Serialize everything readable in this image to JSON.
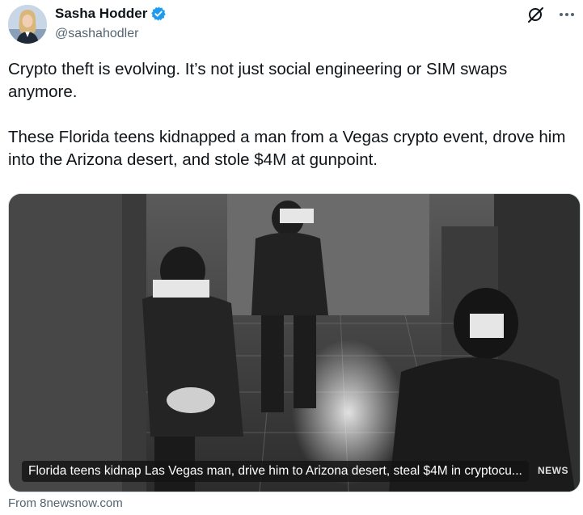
{
  "author": {
    "display_name": "Sasha Hodder",
    "handle": "@sashahodler",
    "verified_color": "#1d9bf0"
  },
  "icons": {
    "avatar": "profile-photo",
    "verified": "verified-badge-icon",
    "grok": "grok-icon",
    "more": "more-horizontal-icon"
  },
  "tweet": {
    "text": "Crypto theft is evolving. It’s not just social engineering or SIM swaps anymore.\n\nThese Florida teens kidnapped a man from a Vegas crypto event, drove him into the Arizona desert, and stole $4M at gunpoint."
  },
  "media": {
    "caption": "Florida teens kidnap Las Vegas man, drive him to Arizona desert, steal $4M in cryptocu...",
    "logo": "NEWS"
  },
  "link_source": "From 8newsnow.com"
}
